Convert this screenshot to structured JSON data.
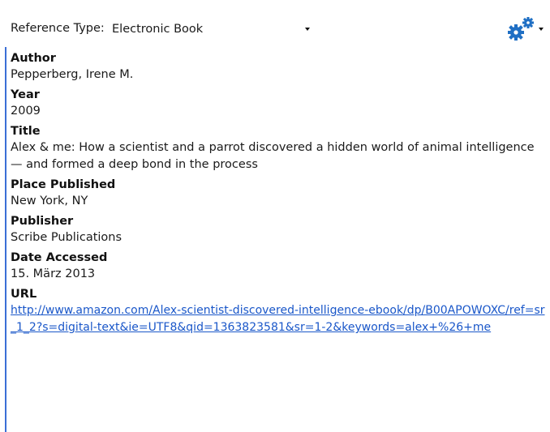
{
  "toolbar": {
    "reference_type_label": "Reference Type:",
    "reference_type_value": "Electronic Book",
    "gear_icon": "gear-icon",
    "gear_color": "#1f6fc4"
  },
  "fields": [
    {
      "label": "Author",
      "value": "Pepperberg, Irene M."
    },
    {
      "label": "Year",
      "value": "2009"
    },
    {
      "label": "Title",
      "value": "Alex & me: How a scientist and a parrot discovered a hidden world of animal intelligence — and formed a deep bond in the process"
    },
    {
      "label": "Place Published",
      "value": "New York, NY"
    },
    {
      "label": "Publisher",
      "value": "Scribe Publications"
    },
    {
      "label": "Date Accessed",
      "value": "15. März 2013"
    },
    {
      "label": "URL",
      "value": "http://www.amazon.com/Alex-scientist-discovered-intelligence-ebook/dp/B00APOWOXC/ref=sr_1_2?s=digital-text&ie=UTF8&qid=1363823581&sr=1-2&keywords=alex+%26+me"
    }
  ],
  "colors": {
    "link": "#1a57c9",
    "accent_line": "#3b6fd6"
  }
}
